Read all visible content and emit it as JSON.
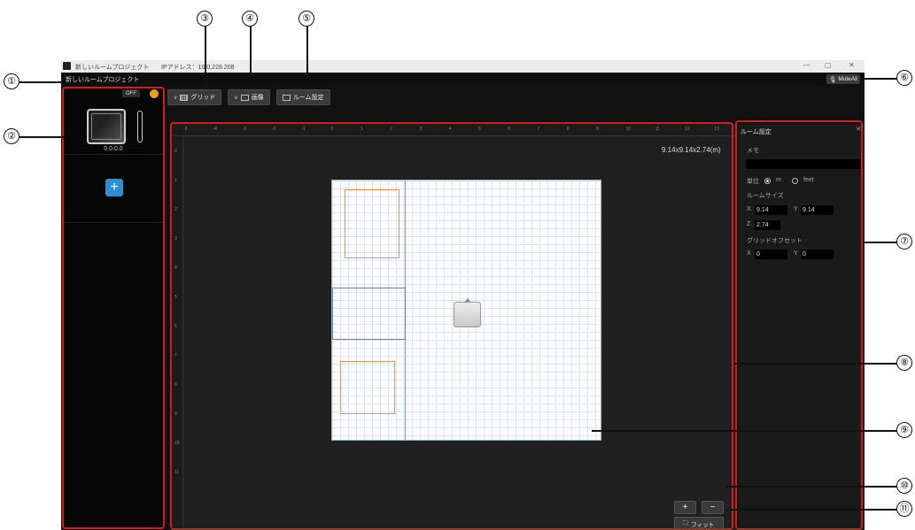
{
  "window": {
    "title": "新しいルームプロジェクト",
    "ip_label": "IPアドレス：10.0.228.208",
    "controls": [
      "—",
      "▢",
      "✕"
    ]
  },
  "project_bar": {
    "project_name": "新しいルームプロジェクト",
    "mute_all_label": "MuteAll"
  },
  "toolbar": {
    "grid_label": "グリッド",
    "image_label": "画像",
    "room_settings_label": "ルーム設定"
  },
  "left_panel": {
    "toggle_label": "OFF",
    "device_ip": "0.0.0.0",
    "add_label": "+"
  },
  "canvas": {
    "ruler_x": [
      "-5",
      "-4",
      "-3",
      "-2",
      "-1",
      "0",
      "1",
      "2",
      "3",
      "4",
      "5",
      "6",
      "7",
      "8",
      "9",
      "10",
      "11",
      "12",
      "13"
    ],
    "ruler_y": [
      "0",
      "1",
      "2",
      "3",
      "4",
      "5",
      "6",
      "7",
      "8",
      "9",
      "10",
      "11"
    ],
    "room_dimensions": "9.14x9.14x2.74(m)",
    "zoom_in_label": "+",
    "zoom_out_label": "−",
    "fit_label": "フィット"
  },
  "room_settings": {
    "title": "ルーム設定",
    "memo_label": "メモ",
    "memo_value": "",
    "unit_label": "単位",
    "unit_options": [
      "m",
      "feet"
    ],
    "unit_selected": "m",
    "room_size_label": "ルームサイズ",
    "x_label": "X",
    "y_label": "Y",
    "z_label": "Z",
    "size_x": "9.14",
    "size_y": "9.14",
    "size_z": "2.74",
    "grid_offset_label": "グリッドオフセット",
    "offset_x": "0",
    "offset_y": "0"
  },
  "callouts": [
    "①",
    "②",
    "③",
    "④",
    "⑤",
    "⑥",
    "⑦",
    "⑧",
    "⑨",
    "⑩",
    "⑪"
  ],
  "colors": {
    "annotation_red": "#d01e1e",
    "accent_blue": "#2e8fd6",
    "toggle_orange": "#f0a020",
    "zone_orange": "#e0965a"
  }
}
